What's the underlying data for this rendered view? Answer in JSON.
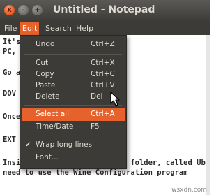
{
  "window": {
    "title": "Untitled - Notepad",
    "buttons": {
      "close": "x",
      "minimize": "-",
      "maximize": "+"
    }
  },
  "menubar": [
    "File",
    "Edit",
    "Search",
    "Help"
  ],
  "document_lines": [
    "It's                    Windows users wh",
    "PC,                     well for us running",
    "Go a                    wnload File link, a",
    "DOV                     EME",
    "Once                    ding, extract the a",
    "EXT",
    "Inside the folder is another folder, called Ub",
    "need to use the Wine Configuration program"
  ],
  "edit_menu": [
    {
      "label": "Undo",
      "accel": "Ctrl+Z"
    },
    {
      "label": "Cut",
      "accel": "Ctrl+X"
    },
    {
      "label": "Copy",
      "accel": "Ctrl+C"
    },
    {
      "label": "Paste",
      "accel": "Ctrl+V"
    },
    {
      "label": "Delete",
      "accel": "Del"
    },
    {
      "label": "Select all",
      "accel": "Ctrl+A"
    },
    {
      "label": "Time/Date",
      "accel": "F5"
    },
    {
      "label": "Wrap long lines",
      "accel": ""
    },
    {
      "label": "Font...",
      "accel": ""
    }
  ],
  "watermark": "wsxdn.com",
  "colors": {
    "accent": "#e6622c",
    "menu_bg": "#3c3b37",
    "menu_text": "#dfdbd2"
  },
  "icons": [
    "close-icon",
    "minimize-icon",
    "maximize-icon",
    "checkmark-icon",
    "mouse-pointer-icon"
  ]
}
